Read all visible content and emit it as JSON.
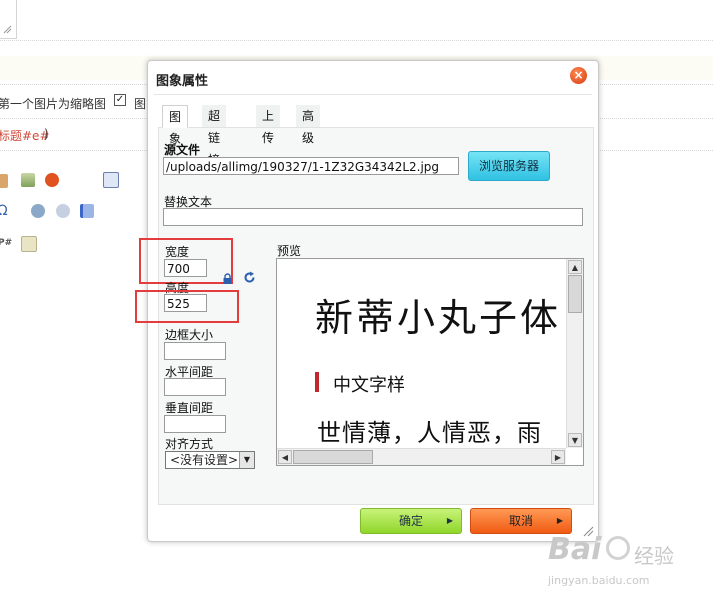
{
  "background": {
    "thumbnail_label": "第一个图片为缩略图",
    "checkbox_mark": "✓",
    "second_label": "图",
    "title_token": "标题#e#",
    "paren": ")"
  },
  "dialog": {
    "title": "图象属性",
    "close_glyph": "×",
    "tabs": [
      {
        "label": "图象"
      },
      {
        "label": "超链接"
      },
      {
        "label": "上传"
      },
      {
        "label": "高级"
      }
    ],
    "source_label": "源文件",
    "source_value": "/uploads/allimg/190327/1-1Z32G34342L2.jpg",
    "browse_button": "浏览服务器",
    "alt_label": "替换文本",
    "alt_value": "",
    "width_label": "宽度",
    "width_value": "700",
    "height_label": "高度",
    "height_value": "525",
    "border_label": "边框大小",
    "border_value": "",
    "hspace_label": "水平间距",
    "hspace_value": "",
    "vspace_label": "垂直间距",
    "vspace_value": "",
    "align_label": "对齐方式",
    "align_value": "<没有设置>",
    "preview_label": "预览",
    "preview_text": {
      "line1": "新蒂小丸子体",
      "line2": "中文字样",
      "line3": "世情薄，人情恶，雨"
    },
    "ok_button": "确定",
    "cancel_button": "取消"
  },
  "watermark": {
    "brand": "Bai",
    "brand2": "经验",
    "url": "jingyan.baidu.com"
  },
  "colors": {
    "accent_red": "#e43c3c",
    "browse_button": "#2fc1e3",
    "ok_button": "#8fd62a",
    "cancel_button": "#f05a12"
  }
}
